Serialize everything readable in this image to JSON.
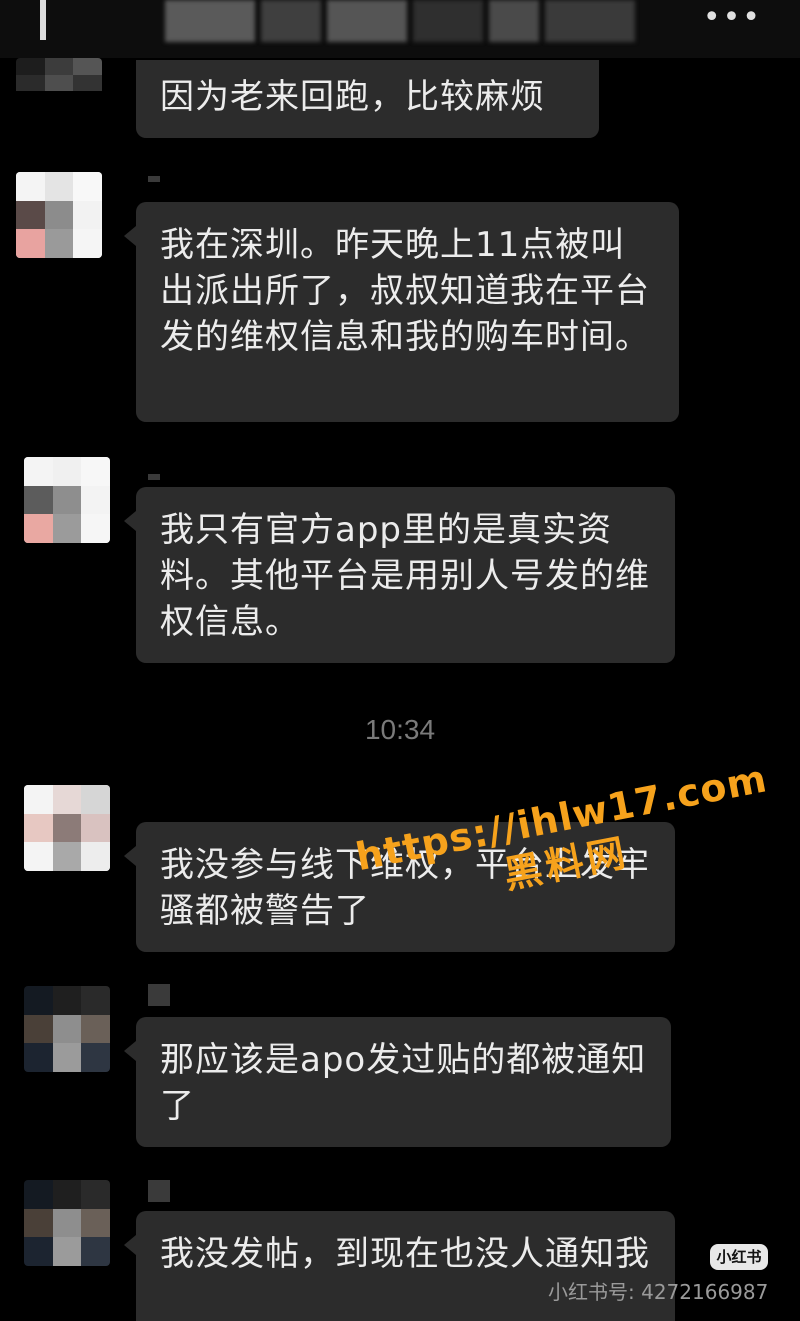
{
  "header": {
    "more_icon": "more-dots-icon",
    "more_glyph": "•••"
  },
  "messages": [
    {
      "text": "因为老来回跑，比较麻烦"
    },
    {
      "text": "我在深圳。昨天晚上11点被叫出派出所了，叔叔知道我在平台发的维权信息和我的购车时间。"
    },
    {
      "text": "我只有官方app里的是真实资料。其他平台是用别人号发的维权信息。"
    },
    {
      "text": "我没参与线下维权，平台上发牢骚都被警告了"
    },
    {
      "text": "那应该是apo发过贴的都被通知了"
    },
    {
      "text": "我没发帖，到现在也没人通知我"
    }
  ],
  "timestamp": "10:34",
  "watermark": {
    "url": "https://ihlw17.com",
    "label": "黑料网"
  },
  "platform": {
    "logo": "小红书",
    "id_text": "小红书号: 4272166987"
  },
  "colors": {
    "background": "#000000",
    "bubble": "#2c2c2c",
    "text": "#ececec",
    "timestamp": "#7a7a7a",
    "watermark": "#f6a21c"
  }
}
